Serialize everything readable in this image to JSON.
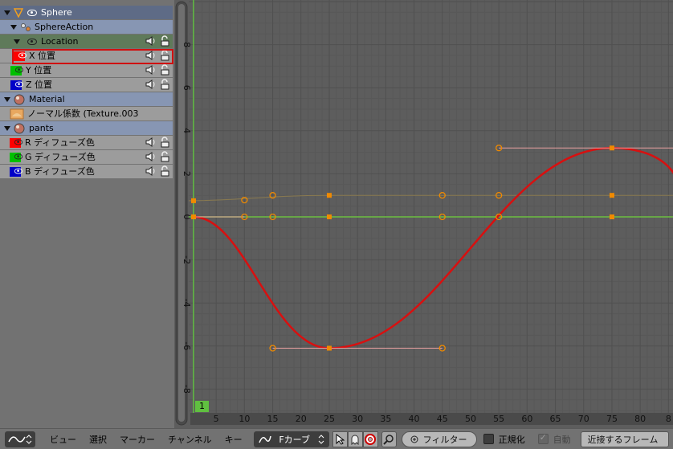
{
  "channels": {
    "rows": [
      {
        "label": "Sphere",
        "kind": "object"
      },
      {
        "label": "SphereAction",
        "kind": "action"
      },
      {
        "label": "Location",
        "kind": "group"
      },
      {
        "label": "X 位置",
        "kind": "curve",
        "color": "#ff0000",
        "selected": true
      },
      {
        "label": "Y 位置",
        "kind": "curve",
        "color": "#00c000"
      },
      {
        "label": "Z 位置",
        "kind": "curve",
        "color": "#0000c8"
      },
      {
        "label": "Material",
        "kind": "matobj"
      },
      {
        "label": "ノーマル係数 (Texture.003",
        "kind": "mattex"
      },
      {
        "label": "pants",
        "kind": "matobj"
      },
      {
        "label": "R ディフューズ色",
        "kind": "curve",
        "color": "#ff0000"
      },
      {
        "label": "G ディフューズ色",
        "kind": "curve",
        "color": "#00c000"
      },
      {
        "label": "B ディフューズ色",
        "kind": "curve",
        "color": "#0000c8"
      }
    ]
  },
  "graph": {
    "current_frame": "1",
    "x_ticks": [
      "5",
      "10",
      "15",
      "20",
      "25",
      "30",
      "35",
      "40",
      "45",
      "50",
      "55",
      "60",
      "65",
      "70",
      "75",
      "80",
      "8"
    ],
    "y_ticks": [
      "8",
      "6",
      "4",
      "2",
      "0",
      "-2",
      "-4",
      "-6",
      "-8"
    ],
    "curves": {
      "x_location_keys": [
        {
          "frame": 1,
          "value": 0
        },
        {
          "frame": 25,
          "value": -6.1
        },
        {
          "frame": 75,
          "value": 3.2
        }
      ],
      "y_location_keys": [
        {
          "frame": 1,
          "value": 0.75
        },
        {
          "frame": 25,
          "value": 1.0
        },
        {
          "frame": 75,
          "value": 1.0
        }
      ],
      "z_location_keys": [
        {
          "frame": 1,
          "value": 0
        },
        {
          "frame": 25,
          "value": 0
        },
        {
          "frame": 75,
          "value": 0
        }
      ]
    },
    "colors": {
      "x_curve": "#d81010",
      "playhead": "#60c040",
      "keyframe": "#f08a00"
    }
  },
  "header": {
    "editor_icon": "graph-editor-icon",
    "menus": [
      "ビュー",
      "選択",
      "マーカー",
      "チャンネル",
      "キー"
    ],
    "mode_dropdown": "Fカーブ",
    "filter_label": "フィルター",
    "normalize_label": "正規化",
    "auto_label": "自動",
    "snap_button": "近接するフレーム"
  }
}
